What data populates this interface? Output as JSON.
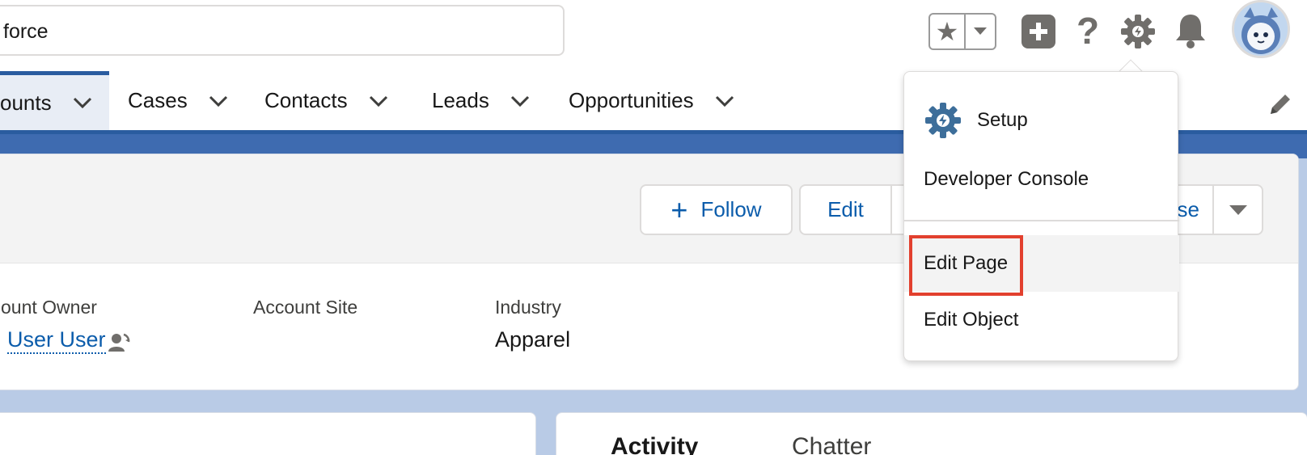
{
  "header": {
    "search_value": "force",
    "icons": [
      "star-icon",
      "chevron-down-icon",
      "plus-icon",
      "help-icon",
      "gear-icon",
      "bell-icon",
      "avatar"
    ]
  },
  "nav": {
    "items": [
      {
        "label": "ounts",
        "active": true
      },
      {
        "label": "Cases",
        "active": false
      },
      {
        "label": "Contacts",
        "active": false
      },
      {
        "label": "Leads",
        "active": false
      },
      {
        "label": "Opportunities",
        "active": false
      }
    ]
  },
  "record": {
    "actions": {
      "follow": "Follow",
      "edit": "Edit",
      "hidden_partial": "se"
    },
    "fields": {
      "owner_label": "ount Owner",
      "owner_value": "User User",
      "site_label": "Account Site",
      "industry_label": "Industry",
      "industry_value": "Apparel"
    }
  },
  "tabs": {
    "activity": "Activity",
    "chatter": "Chatter"
  },
  "setup_menu": {
    "items": [
      {
        "label": "Setup"
      },
      {
        "label": "Developer Console"
      },
      {
        "label": "Edit Page",
        "highlighted": true
      },
      {
        "label": "Edit Object"
      }
    ]
  },
  "colors": {
    "brand_blue": "#2a5c9f",
    "link_blue": "#0b5cab",
    "highlight_red": "#e2402e",
    "icon_gray": "#706e6b"
  }
}
